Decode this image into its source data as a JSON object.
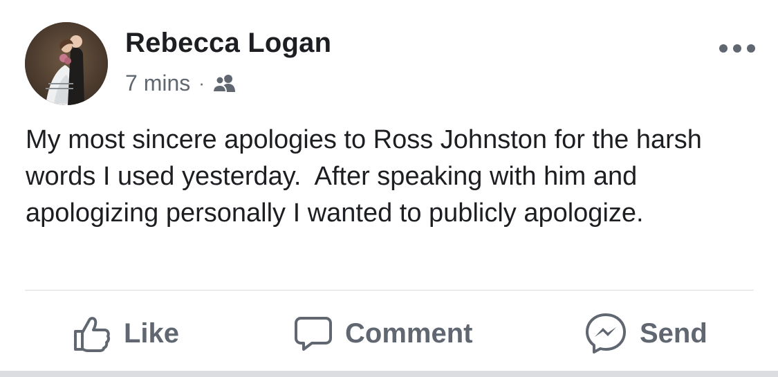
{
  "post": {
    "author": "Rebecca Logan",
    "timestamp": "7 mins",
    "separator": "·",
    "audience_icon": "friends-icon",
    "body": "My most sincere apologies to Ross Johnston for the harsh words I used yesterday.  After speaking with him and apologizing personally I wanted to publicly apologize.",
    "more_icon": "more-options-icon"
  },
  "actions": {
    "like": {
      "label": "Like",
      "icon": "thumbs-up-icon"
    },
    "comment": {
      "label": "Comment",
      "icon": "comment-bubble-icon"
    },
    "send": {
      "label": "Send",
      "icon": "messenger-icon"
    }
  },
  "colors": {
    "text_primary": "#1c1e21",
    "text_secondary": "#606770",
    "divider": "#dadde1",
    "background": "#ffffff"
  }
}
